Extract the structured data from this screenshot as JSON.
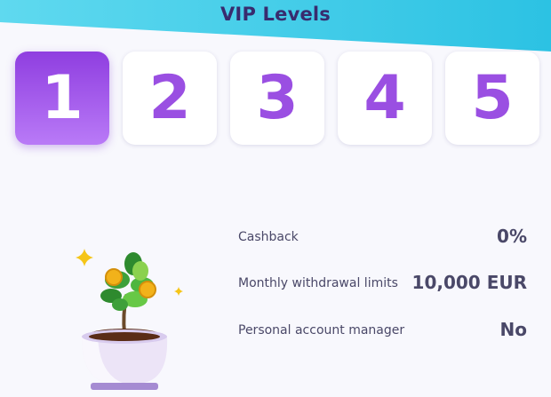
{
  "header": {
    "title": "VIP Levels"
  },
  "levels": [
    {
      "label": "1",
      "active": true
    },
    {
      "label": "2",
      "active": false
    },
    {
      "label": "3",
      "active": false
    },
    {
      "label": "4",
      "active": false
    },
    {
      "label": "5",
      "active": false
    }
  ],
  "benefits": [
    {
      "label": "Cashback",
      "value": "0%"
    },
    {
      "label": "Monthly withdrawal limits",
      "value": "10,000 EUR"
    },
    {
      "label": "Personal account manager",
      "value": "No"
    }
  ],
  "colors": {
    "accent": "#9a4fe2",
    "active_gradient_top": "#8f3ee0",
    "active_gradient_bottom": "#b97af7",
    "header_cyan": "#3fcbe6",
    "text_dark": "#382c6e",
    "text_muted": "#4a4868"
  },
  "illustration": {
    "icon": "money-tree-plant-icon"
  }
}
